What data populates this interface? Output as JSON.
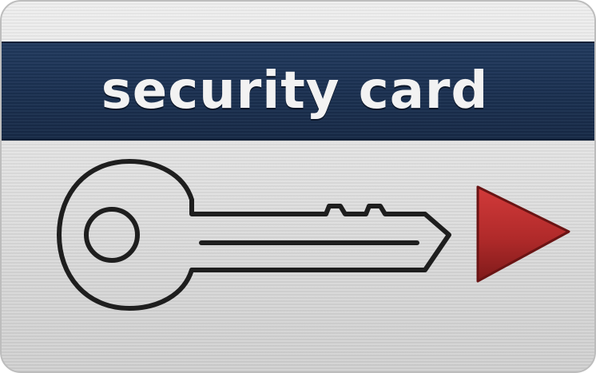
{
  "card": {
    "title": "security card",
    "stripe_color": "#1b3152",
    "body_color": "#e2e2e2",
    "arrow_color": "#b02a2a"
  },
  "icons": {
    "key": "key-icon",
    "arrow": "play-arrow-icon"
  }
}
